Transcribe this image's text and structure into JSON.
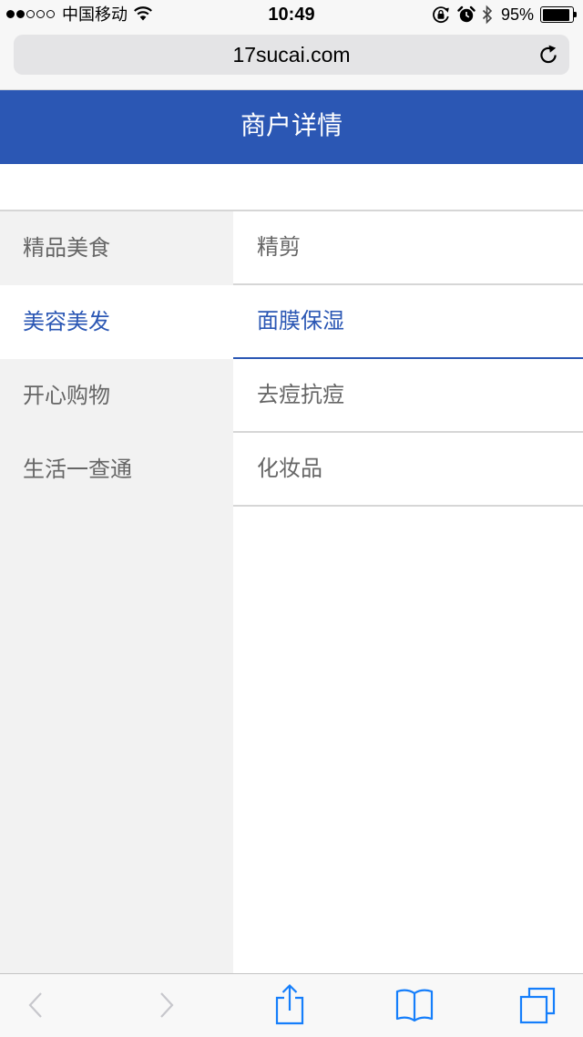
{
  "status_bar": {
    "signal_strength": 2,
    "signal_max": 5,
    "carrier": "中国移动",
    "time": "10:49",
    "battery_text": "95%",
    "battery_level": 0.95,
    "icons": [
      "wifi-icon",
      "rotation-lock-icon",
      "alarm-icon",
      "bluetooth-icon",
      "battery-icon"
    ]
  },
  "browser": {
    "url": "17sucai.com",
    "reload_icon": "reload-icon"
  },
  "header": {
    "title": "商户详情"
  },
  "categories": [
    {
      "label": "精品美食",
      "active": false
    },
    {
      "label": "美容美发",
      "active": true
    },
    {
      "label": "开心购物",
      "active": false
    },
    {
      "label": "生活一查通",
      "active": false
    }
  ],
  "subcategories": [
    {
      "label": "精剪",
      "active": false
    },
    {
      "label": "面膜保湿",
      "active": true
    },
    {
      "label": "去痘抗痘",
      "active": false
    },
    {
      "label": "化妆品",
      "active": false
    }
  ],
  "toolbar": {
    "icons": [
      "back-icon",
      "forward-icon",
      "share-icon",
      "bookmarks-icon",
      "tabs-icon"
    ]
  },
  "colors": {
    "accent": "#2b57b4",
    "ios_blue": "#157efb",
    "text_muted": "#666666",
    "sidebar_bg": "#f2f2f2",
    "divider": "#d6d6d6",
    "disabled_icon": "#c7c7cc"
  }
}
